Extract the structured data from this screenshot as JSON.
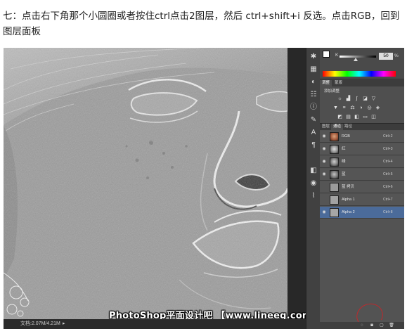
{
  "article": {
    "instruction_line1": "七：点击右下角那个小圆圈或者按住ctrl点击2图层，然后 ctrl+shift+i 反选。点击RGB，回到",
    "instruction_line2": "图层面板"
  },
  "watermark": "PhotoShop平面设计吧 【www.lineeg.com/tieba/1783】",
  "status_bar": {
    "doc_info": "文档:2.07M/4.21M"
  },
  "color_panel": {
    "k_label": "K",
    "k_value": "50",
    "k_unit": "%"
  },
  "adjustments_panel": {
    "tabs": [
      "调整",
      "蒙版"
    ],
    "title": "添加调整",
    "icons": [
      "brightness-icon",
      "levels-icon",
      "curves-icon",
      "exposure-icon",
      "vibrance-icon",
      "hue-icon",
      "balance-icon",
      "bw-icon",
      "photo-filter-icon",
      "channel-mixer-icon",
      "invert-icon",
      "posterize-icon",
      "threshold-icon",
      "gradient-map-icon",
      "selective-color-icon"
    ]
  },
  "layers_panel": {
    "tabs": [
      "图层",
      "通道",
      "路径"
    ],
    "active_tab": "通道",
    "rows": [
      {
        "name": "RGB",
        "shortcut": "Ctrl+2",
        "thumb": "face"
      },
      {
        "name": "红",
        "shortcut": "Ctrl+3",
        "thumb": "gray-face"
      },
      {
        "name": "绿",
        "shortcut": "Ctrl+4",
        "thumb": "gray-face"
      },
      {
        "name": "蓝",
        "shortcut": "Ctrl+5",
        "thumb": "gray-face"
      },
      {
        "name": "蓝 拷贝",
        "shortcut": "Ctrl+6",
        "thumb": "gray"
      },
      {
        "name": "Alpha 1",
        "shortcut": "Ctrl+7",
        "thumb": "gray"
      },
      {
        "name": "Alpha 2",
        "shortcut": "Ctrl+8",
        "thumb": "gray"
      }
    ],
    "selected_row": "Alpha 2"
  },
  "colors": {
    "selected_row": "#4b6b9a",
    "annotation_circle": "#c0282c",
    "canvas_gray": "#9a9a9a"
  }
}
